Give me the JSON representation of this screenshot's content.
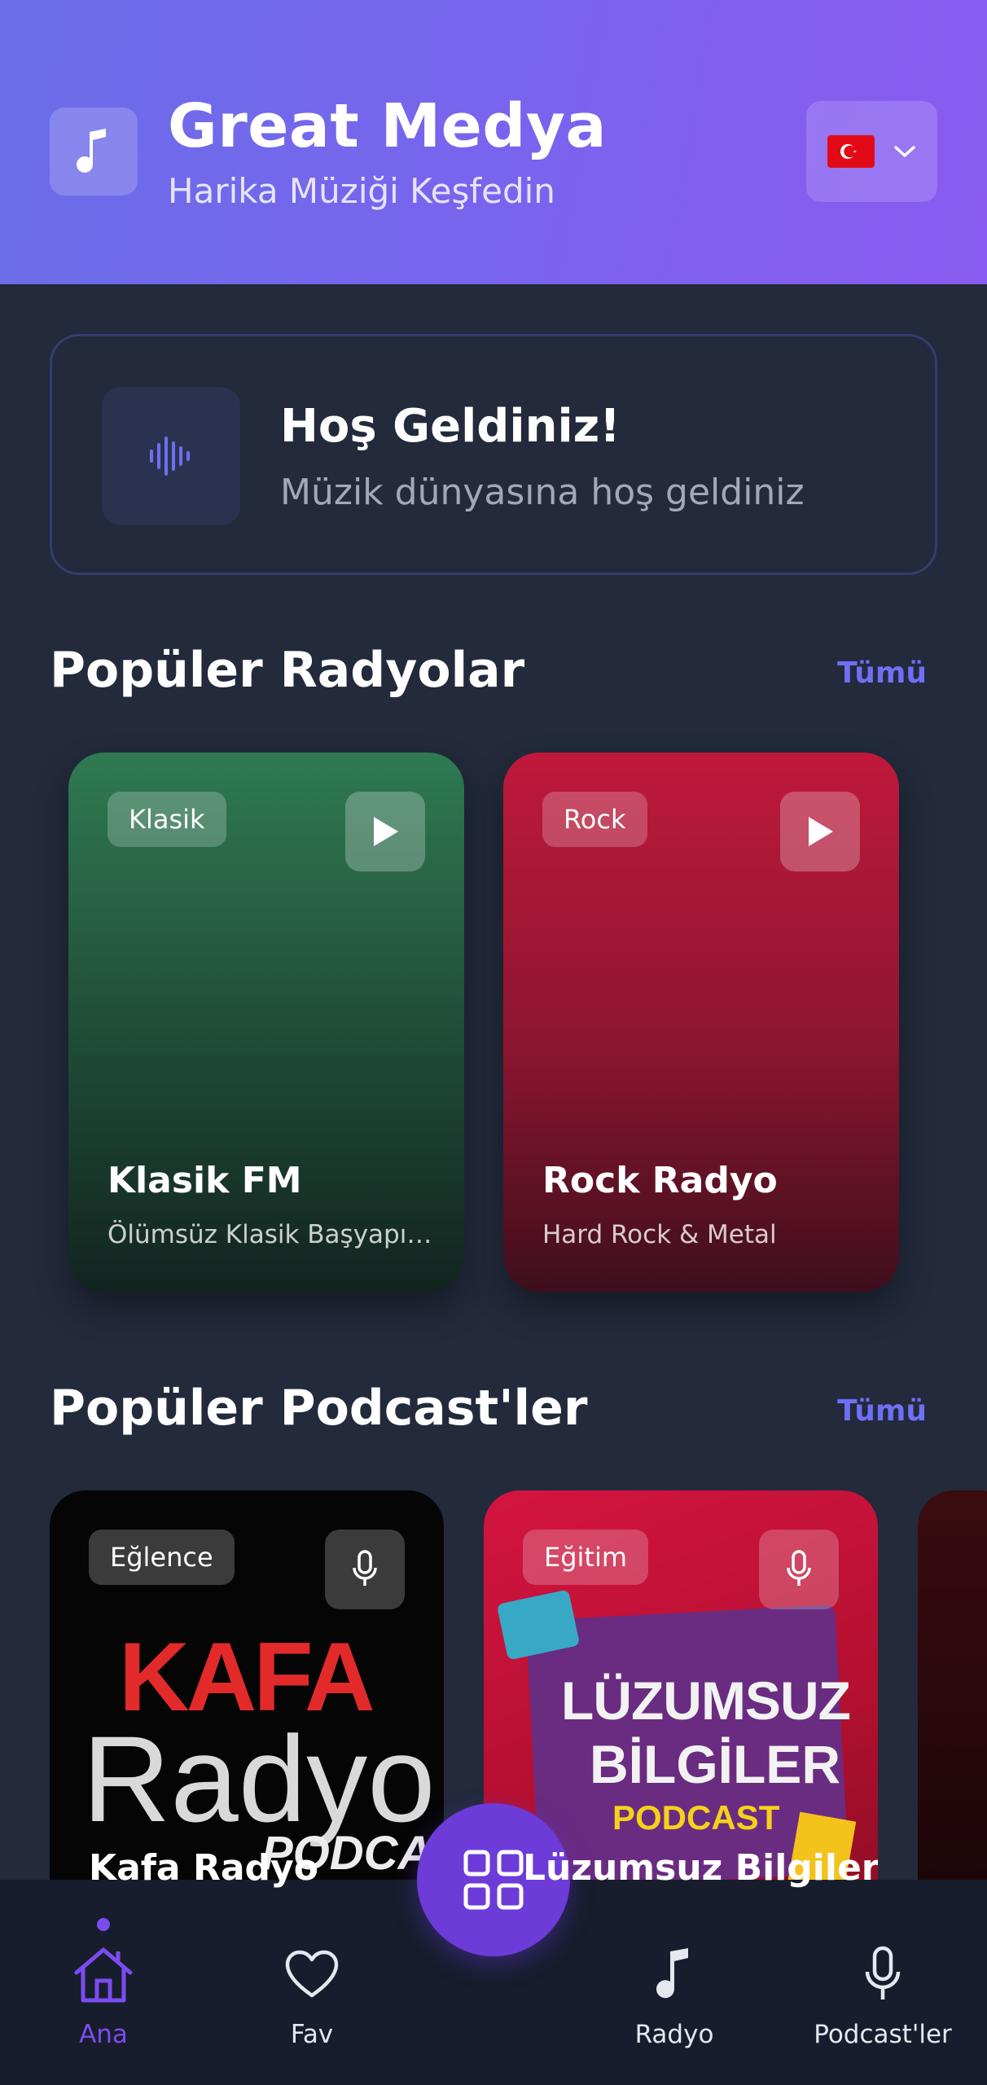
{
  "header": {
    "title": "Great Medya",
    "subtitle": "Harika Müziği Keşfedin",
    "logo_icon": "music-note-icon",
    "language_flag": "turkey-flag-icon"
  },
  "welcome": {
    "title": "Hoş Geldiniz!",
    "text": "Müzik dünyasına hoş geldiniz",
    "icon": "audio-wave-icon"
  },
  "radios": {
    "section_title": "Popüler Radyolar",
    "see_all": "Tümü",
    "items": [
      {
        "genre": "Klasik",
        "title": "Klasik FM",
        "subtitle": "Ölümsüz Klasik Başyapıtlar",
        "color": "#2f7a52"
      },
      {
        "genre": "Rock",
        "title": "Rock Radyo",
        "subtitle": "Hard Rock & Metal",
        "color": "#c0193b"
      }
    ]
  },
  "podcasts": {
    "section_title": "Popüler Podcast'ler",
    "see_all": "Tümü",
    "items": [
      {
        "category": "Eğlence",
        "title": "Kafa Radyo",
        "art_line1": "KAFA",
        "art_line2": "Radyo",
        "art_line3": "PODCAST"
      },
      {
        "category": "Eğitim",
        "title": "Lüzumsuz Bilgiler",
        "art_line1": "LÜZUMSUZ",
        "art_line2": "BİLGİLER",
        "art_line3": "PODCAST"
      }
    ]
  },
  "nav": {
    "items": [
      {
        "label": "Ana",
        "icon": "home-icon",
        "active": true
      },
      {
        "label": "Fav",
        "icon": "heart-icon",
        "active": false
      },
      {
        "label": "Radyo",
        "icon": "music-note-icon",
        "active": false
      },
      {
        "label": "Podcast'ler",
        "icon": "microphone-icon",
        "active": false
      }
    ],
    "center_icon": "grid-icon"
  },
  "colors": {
    "accent": "#7b4cf0",
    "link": "#6f6ff5",
    "background": "#222a3b"
  }
}
